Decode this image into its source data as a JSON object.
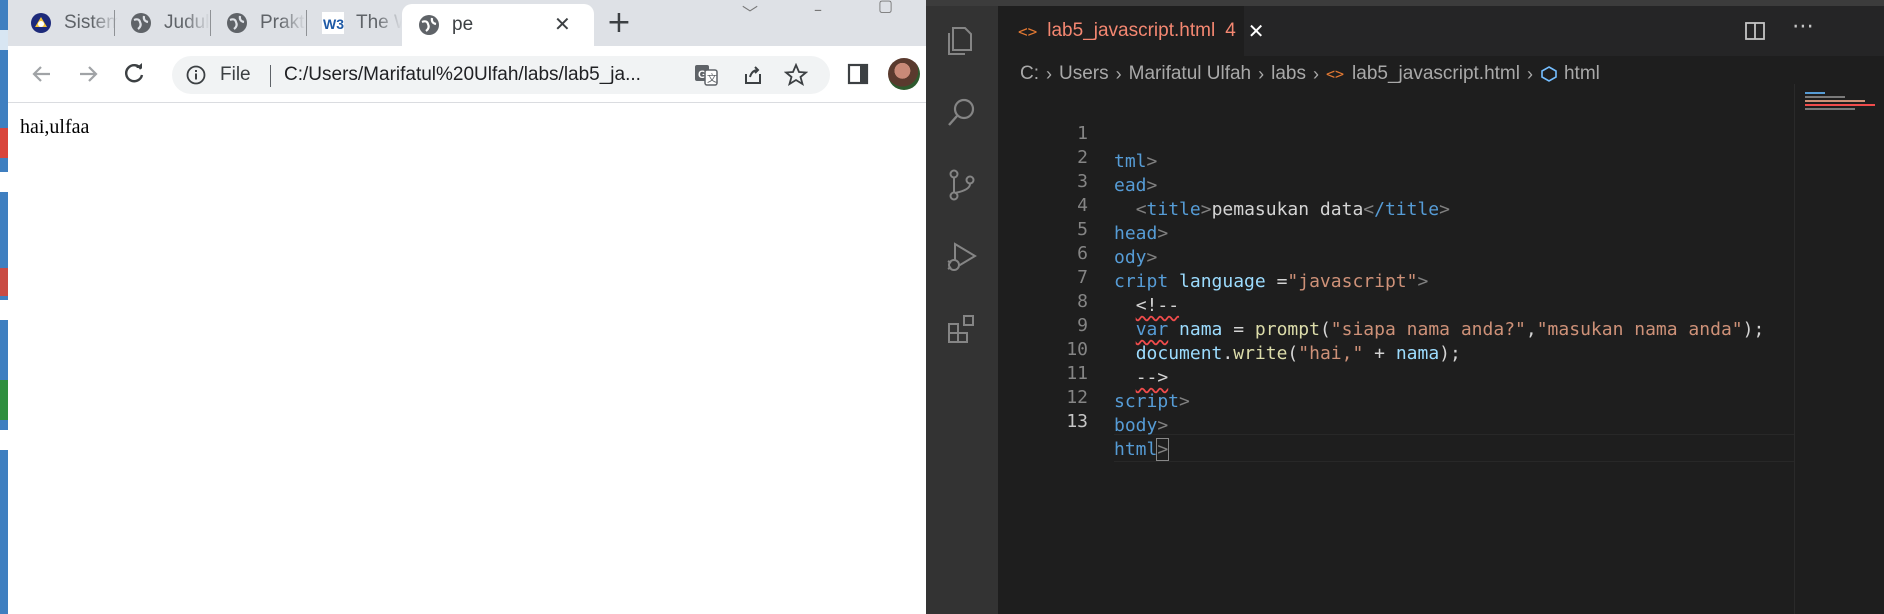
{
  "browser": {
    "tabs": [
      {
        "label": "Sistem",
        "icon": "university-logo-icon",
        "active": false
      },
      {
        "label": "Judul I",
        "icon": "globe-icon",
        "active": false
      },
      {
        "label": "Praktik",
        "icon": "globe-icon",
        "active": false
      },
      {
        "label": "The W",
        "icon": "w3schools-logo-icon",
        "active": false
      },
      {
        "label": "pe",
        "icon": "globe-icon",
        "active": true
      }
    ],
    "new_tab_label": "+",
    "close_label": "✕",
    "address": {
      "scheme_label": "File",
      "url": "C:/Users/Marifatul%20Ulfah/labs/lab5_ja..."
    },
    "page_text": "hai,ulfaa"
  },
  "editor": {
    "tab": {
      "filename": "lab5_javascript.html",
      "problems": "4",
      "close": "✕"
    },
    "breadcrumbs": [
      "C:",
      "Users",
      "Marifatul Ulfah",
      "labs",
      "lab5_javascript.html",
      "html"
    ],
    "lines": [
      {
        "n": "1"
      },
      {
        "n": "2"
      },
      {
        "n": "3"
      },
      {
        "n": "4"
      },
      {
        "n": "5"
      },
      {
        "n": "6"
      },
      {
        "n": "7"
      },
      {
        "n": "8"
      },
      {
        "n": "9"
      },
      {
        "n": "10"
      },
      {
        "n": "11"
      },
      {
        "n": "12"
      },
      {
        "n": "13"
      }
    ],
    "code": {
      "l1": "tml",
      "l2": "ead",
      "l3_open": "title",
      "l3_text": "pemasukan data",
      "l3_close": "/title",
      "l4": "head",
      "l5": "ody",
      "l6_tag": "cript",
      "l6_attr": "language",
      "l6_eq": " =",
      "l6_val": "\"javascript\"",
      "l7": "<!--",
      "l8_kw": "var",
      "l8_var": "nama",
      "l8_eq": " = ",
      "l8_fn": "prompt",
      "l8_s1": "\"siapa nama anda?\"",
      "l8_comma": ",",
      "l8_s2": "\"masukan nama anda\"",
      "l8_end": ");",
      "l9_obj": "document",
      "l9_dot": ".",
      "l9_fn": "write",
      "l9_s": "\"hai,\"",
      "l9_plus": " + ",
      "l9_var": "nama",
      "l9_end": ");",
      "l10": "-->",
      "l11": "script",
      "l12": "body",
      "l13": "html"
    },
    "colors": {
      "tag": "#569cd6",
      "string": "#ce9178",
      "function": "#dcdcaa",
      "error": "#f48771"
    }
  }
}
